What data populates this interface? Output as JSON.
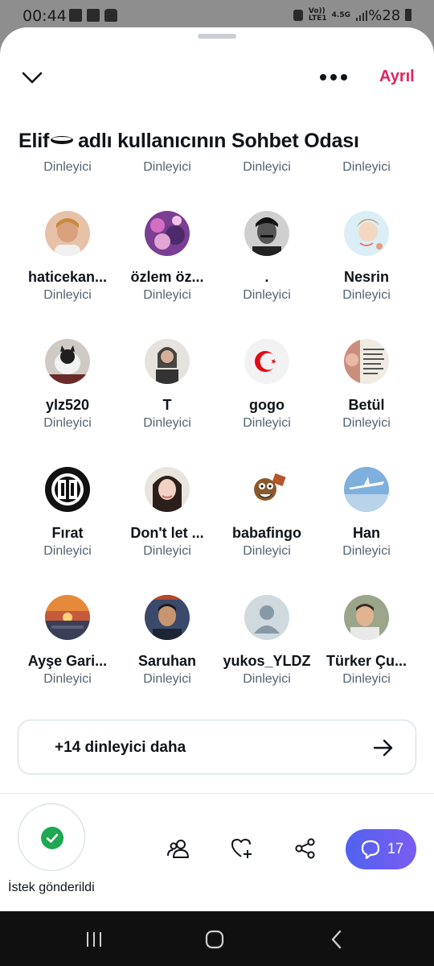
{
  "status_bar": {
    "time": "00:44",
    "net_label_top": "Vo))",
    "net_label_bottom": "LTE1",
    "net_type": "4.5G",
    "battery": "%28",
    "icons": [
      "gallery-icon",
      "mail-icon",
      "lock-icon",
      "data-saver-icon",
      "signal-icon",
      "battery-icon"
    ]
  },
  "header": {
    "leave_label": "Ayrıl",
    "title_before": "Elif",
    "title_after": "adlı kullanıcının Sohbet Odası"
  },
  "cut_row": [
    "Dinleyici",
    "Dinleyici",
    "Dinleyici",
    "Dinleyici"
  ],
  "listeners": [
    {
      "name": "haticekan...",
      "role": "Dinleyici"
    },
    {
      "name": "özlem öz...",
      "role": "Dinleyici"
    },
    {
      "name": ".",
      "role": "Dinleyici"
    },
    {
      "name": "Nesrin",
      "role": "Dinleyici"
    },
    {
      "name": "ylz520",
      "role": "Dinleyici"
    },
    {
      "name": "T",
      "role": "Dinleyici"
    },
    {
      "name": "gogo",
      "role": "Dinleyici"
    },
    {
      "name": "Betül",
      "role": "Dinleyici"
    },
    {
      "name": "Fırat",
      "role": "Dinleyici"
    },
    {
      "name": "Don't let ...",
      "role": "Dinleyici"
    },
    {
      "name": "babafingo",
      "role": "Dinleyici"
    },
    {
      "name": "Han",
      "role": "Dinleyici"
    },
    {
      "name": "Ayşe Gari...",
      "role": "Dinleyici"
    },
    {
      "name": "Saruhan",
      "role": "Dinleyici"
    },
    {
      "name": "yukos_YLDZ",
      "role": "Dinleyici"
    },
    {
      "name": "Türker Çu...",
      "role": "Dinleyici"
    }
  ],
  "more_listeners": {
    "label": "+14 dinleyici daha"
  },
  "bottom_bar": {
    "request_label": "İstek gönderildi",
    "chat_count": "17"
  },
  "colors": {
    "accent_red": "#e0245e",
    "check_green": "#1da851",
    "chat_gradient_start": "#5163f0",
    "chat_gradient_end": "#7a5cf0",
    "muted_text": "#536471"
  }
}
